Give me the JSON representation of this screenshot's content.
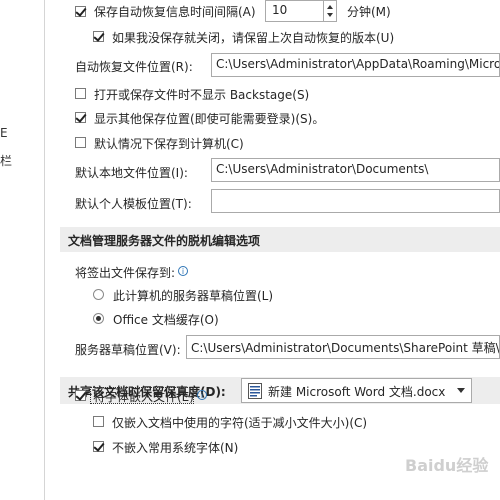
{
  "sidebar": {
    "frag1": "E",
    "frag2": "栏"
  },
  "autorecover": {
    "interval_label": "保存自动恢复信息时间间隔(A)",
    "interval_value": "10",
    "interval_unit": "分钟(M)",
    "keep_last_label": "如果我没保存就关闭，请保留上次自动恢复的版本(U)",
    "location_label": "自动恢复文件位置(R):",
    "location_value": "C:\\Users\\Administrator\\AppData\\Roaming\\Micros"
  },
  "options": {
    "no_backstage_label": "打开或保存文件时不显示 Backstage(S)",
    "show_other_locations_label": "显示其他保存位置(即使可能需要登录)(S)。",
    "save_to_computer_label": "默认情况下保存到计算机(C)"
  },
  "local": {
    "default_location_label": "默认本地文件位置(I):",
    "default_location_value": "C:\\Users\\Administrator\\Documents\\",
    "template_location_label": "默认个人模板位置(T):",
    "template_location_value": ""
  },
  "server_section": {
    "title": "文档管理服务器文件的脱机编辑选项",
    "save_checkout_label": "将签出文件保存到:",
    "radio_server_drafts": "此计算机的服务器草稿位置(L)",
    "radio_office_cache": "Office 文档缓存(O)",
    "drafts_location_label": "服务器草稿位置(V):",
    "drafts_location_value": "C:\\Users\\Administrator\\Documents\\SharePoint 草稿\\"
  },
  "fidelity": {
    "title": "共享该文档时保留保真度(D):",
    "doc_name": "新建 Microsoft Word 文档.docx",
    "embed_fonts_label": "将字体嵌入文件(E)",
    "embed_used_chars_label": "仅嵌入文档中使用的字符(适于减小文件大小)(C)",
    "no_common_fonts_label": "不嵌入常用系统字体(N)"
  },
  "watermark": "Baidu经验",
  "colors": {
    "section_bg": "#ededed",
    "accent": "#2e75b6",
    "word_icon": "#2b579a"
  }
}
